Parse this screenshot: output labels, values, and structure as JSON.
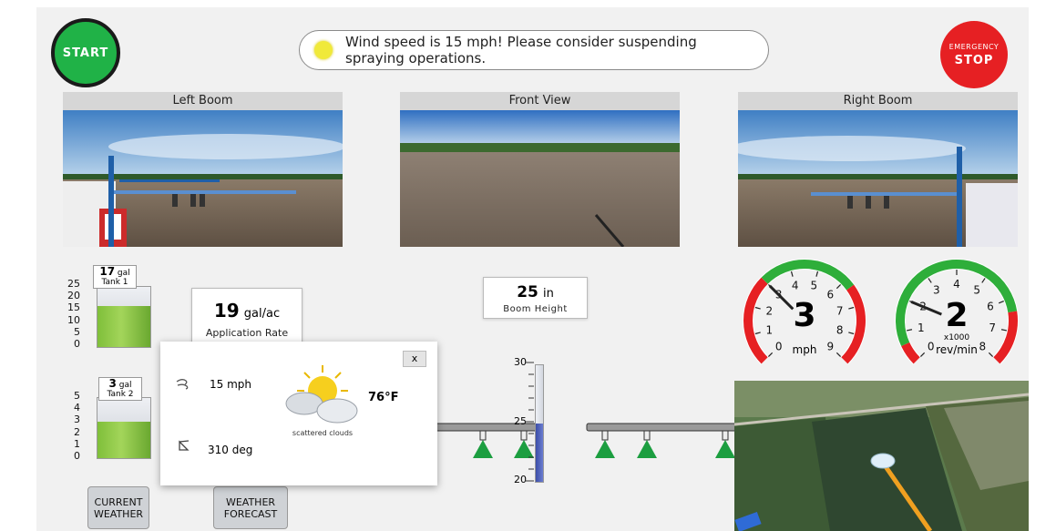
{
  "header": {
    "start_label": "START",
    "alert_text_line1": "Wind speed is 15 mph! Please consider suspending",
    "alert_text_line2": "spraying operations.",
    "emergency_small": "EMERGENCY",
    "emergency_large": "STOP"
  },
  "cameras": {
    "left": "Left Boom",
    "front": "Front View",
    "right": "Right Boom"
  },
  "tank1": {
    "value": "17",
    "unit": "gal",
    "name": "Tank 1",
    "scale": [
      "25",
      "20",
      "15",
      "10",
      "5",
      "0"
    ],
    "fill_fraction": 0.68
  },
  "tank2": {
    "value": "3",
    "unit": "gal",
    "name": "Tank 2",
    "scale": [
      "5",
      "4",
      "3",
      "2",
      "1",
      "0"
    ],
    "fill_fraction": 0.6
  },
  "application_rate": {
    "value": "19",
    "unit": "gal/ac",
    "label": "Application Rate"
  },
  "boom_height": {
    "value": "25",
    "unit": "in",
    "label": "Boom Height",
    "scale": [
      "30",
      "25",
      "20"
    ],
    "fill_fraction": 0.5
  },
  "speed_gauge": {
    "value": "3",
    "unit": "mph",
    "ticks": [
      "0",
      "1",
      "2",
      "3",
      "4",
      "5",
      "6",
      "7",
      "8",
      "9"
    ]
  },
  "rpm_gauge": {
    "value": "2",
    "multiplier": "x1000",
    "unit": "rev/min",
    "ticks": [
      "0",
      "1",
      "2",
      "3",
      "4",
      "5",
      "6",
      "7",
      "8"
    ]
  },
  "weather_popup": {
    "close": "x",
    "wind_speed": "15 mph",
    "wind_direction": "310 deg",
    "condition": "scattered clouds",
    "temperature": "76°F"
  },
  "buttons": {
    "current_weather_1": "CURRENT",
    "current_weather_2": "WEATHER",
    "weather_forecast_1": "WEATHER",
    "weather_forecast_2": "FORECAST"
  },
  "colors": {
    "start": "#20b247",
    "stop": "#e62023",
    "gauge_green": "#2eae3a",
    "gauge_red": "#e62023",
    "nozzle": "#1c9e40",
    "height_fill": "#4a5bb8"
  }
}
